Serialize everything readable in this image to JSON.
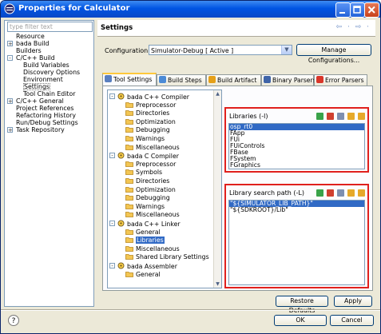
{
  "window": {
    "title": "Properties for Calculator"
  },
  "filter": {
    "placeholder": "type filter text"
  },
  "nav_tree": [
    {
      "label": "Resource",
      "depth": 0,
      "toggle": ""
    },
    {
      "label": "bada Build",
      "depth": 0,
      "toggle": "+"
    },
    {
      "label": "Builders",
      "depth": 0,
      "toggle": ""
    },
    {
      "label": "C/C++ Build",
      "depth": 0,
      "toggle": "-"
    },
    {
      "label": "Build Variables",
      "depth": 1,
      "toggle": ""
    },
    {
      "label": "Discovery Options",
      "depth": 1,
      "toggle": ""
    },
    {
      "label": "Environment",
      "depth": 1,
      "toggle": ""
    },
    {
      "label": "Settings",
      "depth": 1,
      "toggle": "",
      "selected": true
    },
    {
      "label": "Tool Chain Editor",
      "depth": 1,
      "toggle": ""
    },
    {
      "label": "C/C++ General",
      "depth": 0,
      "toggle": "+"
    },
    {
      "label": "Project References",
      "depth": 0,
      "toggle": ""
    },
    {
      "label": "Refactoring History",
      "depth": 0,
      "toggle": ""
    },
    {
      "label": "Run/Debug Settings",
      "depth": 0,
      "toggle": ""
    },
    {
      "label": "Task Repository",
      "depth": 0,
      "toggle": "+"
    }
  ],
  "page": {
    "title": "Settings",
    "nav_glyphs": "⇦ · ⇨ ·"
  },
  "configuration": {
    "label": "Configuration:",
    "value": "Simulator-Debug  [ Active ]",
    "manage_label": "Manage Configurations..."
  },
  "tabs": [
    {
      "label": "Tool Settings",
      "active": true
    },
    {
      "label": "Build Steps"
    },
    {
      "label": "Build Artifact"
    },
    {
      "label": "Binary Parsers"
    },
    {
      "label": "Error Parsers"
    }
  ],
  "tool_tree": [
    {
      "label": "bada C++ Compiler",
      "type": "tool",
      "toggle": "-"
    },
    {
      "label": "Preprocessor",
      "type": "option"
    },
    {
      "label": "Directories",
      "type": "option"
    },
    {
      "label": "Optimization",
      "type": "option"
    },
    {
      "label": "Debugging",
      "type": "option"
    },
    {
      "label": "Warnings",
      "type": "option"
    },
    {
      "label": "Miscellaneous",
      "type": "option"
    },
    {
      "label": "bada C Compiler",
      "type": "tool",
      "toggle": "-"
    },
    {
      "label": "Preprocessor",
      "type": "option"
    },
    {
      "label": "Symbols",
      "type": "option"
    },
    {
      "label": "Directories",
      "type": "option"
    },
    {
      "label": "Optimization",
      "type": "option"
    },
    {
      "label": "Debugging",
      "type": "option"
    },
    {
      "label": "Warnings",
      "type": "option"
    },
    {
      "label": "Miscellaneous",
      "type": "option"
    },
    {
      "label": "bada C++ Linker",
      "type": "tool",
      "toggle": "-"
    },
    {
      "label": "General",
      "type": "option"
    },
    {
      "label": "Libraries",
      "type": "option",
      "selected": true
    },
    {
      "label": "Miscellaneous",
      "type": "option"
    },
    {
      "label": "Shared Library Settings",
      "type": "option"
    },
    {
      "label": "bada Assembler",
      "type": "tool",
      "toggle": "-"
    },
    {
      "label": "General",
      "type": "option"
    }
  ],
  "libraries": {
    "label": "Libraries (-l)",
    "items": [
      "osp_rt0",
      "FApp",
      "FUi",
      "FUiControls",
      "FBase",
      "FSystem",
      "FGraphics"
    ]
  },
  "library_paths": {
    "label": "Library search path (-L)",
    "items": [
      "\"${SIMULATOR_LIB_PATH}\"",
      "\"${SDKROOT}/Lib\""
    ]
  },
  "buttons": {
    "restore": "Restore Defaults",
    "apply": "Apply",
    "ok": "OK",
    "cancel": "Cancel",
    "help": "?"
  },
  "colors": {
    "selection": "#316ac5",
    "highlight_box": "#e0201d",
    "title_bar": "#0054e3"
  }
}
